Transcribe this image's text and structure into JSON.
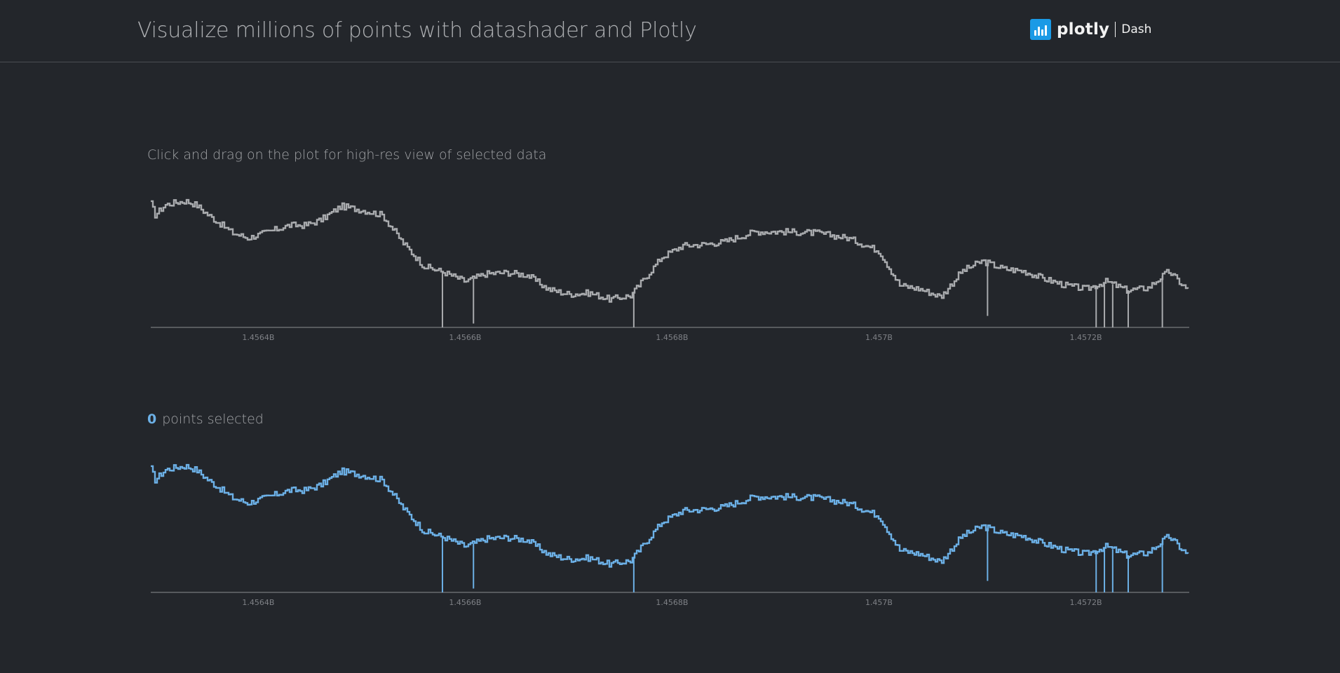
{
  "header": {
    "title": "Visualize millions of points with datashader and Plotly",
    "logo_word": "plotly",
    "logo_dash": "Dash"
  },
  "instruction": "Click and drag on the plot for high-res view of selected data",
  "selection": {
    "count": "0",
    "label": "points selected"
  },
  "colors": {
    "background": "#23262b",
    "overview_line": "#a9abae",
    "selection_line": "#6cb0e6",
    "axis": "#8b8e92",
    "brand": "#1a9ae6"
  },
  "chart_data": [
    {
      "type": "line",
      "title": "",
      "xlabel": "",
      "ylabel": "",
      "x_ticks": [
        "1.4564B",
        "1.4566B",
        "1.4568B",
        "1.457B",
        "1.4572B"
      ],
      "xlim": [
        1456296000,
        1457300000
      ],
      "ylim": [
        0,
        1
      ],
      "grid": false,
      "y_axis_visible": false,
      "series": [
        {
          "x": [
            1456296000,
            1456300000,
            1456310000,
            1456320000,
            1456330000,
            1456340000,
            1456350000,
            1456360000,
            1456375000,
            1456390000,
            1456410000,
            1456430000,
            1456445000,
            1456460000,
            1456480000,
            1456500000,
            1456520000,
            1456540000,
            1456560000,
            1456580000,
            1456600000,
            1456620000,
            1456640000,
            1456660000,
            1456680000,
            1456700000,
            1456720000,
            1456740000,
            1456760000,
            1456790000,
            1456810000,
            1456830000,
            1456850000,
            1456880000,
            1456910000,
            1456940000,
            1456970000,
            1457000000,
            1457020000,
            1457040000,
            1457060000,
            1457080000,
            1457100000,
            1457120000,
            1457140000,
            1457160000,
            1457180000,
            1457200000,
            1457220000,
            1457240000,
            1457260000,
            1457280000,
            1457300000
          ],
          "y": [
            0.97,
            0.88,
            0.96,
            0.98,
            0.99,
            0.96,
            0.89,
            0.83,
            0.74,
            0.7,
            0.75,
            0.8,
            0.8,
            0.84,
            0.95,
            0.92,
            0.88,
            0.66,
            0.48,
            0.43,
            0.36,
            0.42,
            0.43,
            0.41,
            0.3,
            0.26,
            0.27,
            0.22,
            0.25,
            0.55,
            0.64,
            0.65,
            0.67,
            0.75,
            0.75,
            0.74,
            0.7,
            0.6,
            0.33,
            0.3,
            0.24,
            0.44,
            0.52,
            0.46,
            0.44,
            0.38,
            0.33,
            0.3,
            0.36,
            0.29,
            0.31,
            0.44,
            0.28
          ]
        }
      ],
      "spikes": [
        {
          "x": 1456578000,
          "low": 0.0
        },
        {
          "x": 1456608000,
          "low": 0.03
        },
        {
          "x": 1456763000,
          "low": 0.0
        },
        {
          "x": 1457105000,
          "low": 0.09
        },
        {
          "x": 1457210000,
          "low": 0.0
        },
        {
          "x": 1457218000,
          "low": 0.0
        },
        {
          "x": 1457226000,
          "low": 0.0
        },
        {
          "x": 1457241000,
          "low": 0.0
        },
        {
          "x": 1457274000,
          "low": 0.0
        }
      ]
    },
    {
      "type": "line",
      "title": "",
      "xlabel": "",
      "ylabel": "",
      "x_ticks": [
        "1.4564B",
        "1.4566B",
        "1.4568B",
        "1.457B",
        "1.4572B"
      ],
      "xlim": [
        1456296000,
        1457300000
      ],
      "ylim": [
        0,
        1
      ],
      "grid": false,
      "y_axis_visible": false,
      "series": [
        {
          "x": [
            1456296000,
            1456300000,
            1456310000,
            1456320000,
            1456330000,
            1456340000,
            1456350000,
            1456360000,
            1456375000,
            1456390000,
            1456410000,
            1456430000,
            1456445000,
            1456460000,
            1456480000,
            1456500000,
            1456520000,
            1456540000,
            1456560000,
            1456580000,
            1456600000,
            1456620000,
            1456640000,
            1456660000,
            1456680000,
            1456700000,
            1456720000,
            1456740000,
            1456760000,
            1456790000,
            1456810000,
            1456830000,
            1456850000,
            1456880000,
            1456910000,
            1456940000,
            1456970000,
            1457000000,
            1457020000,
            1457040000,
            1457060000,
            1457080000,
            1457100000,
            1457120000,
            1457140000,
            1457160000,
            1457180000,
            1457200000,
            1457220000,
            1457240000,
            1457260000,
            1457280000,
            1457300000
          ],
          "y": [
            0.97,
            0.88,
            0.96,
            0.98,
            0.99,
            0.96,
            0.89,
            0.83,
            0.74,
            0.7,
            0.75,
            0.8,
            0.8,
            0.84,
            0.95,
            0.92,
            0.88,
            0.66,
            0.48,
            0.43,
            0.36,
            0.42,
            0.43,
            0.41,
            0.3,
            0.26,
            0.27,
            0.22,
            0.25,
            0.55,
            0.64,
            0.65,
            0.67,
            0.75,
            0.75,
            0.74,
            0.7,
            0.6,
            0.33,
            0.3,
            0.24,
            0.44,
            0.52,
            0.46,
            0.44,
            0.38,
            0.33,
            0.3,
            0.36,
            0.29,
            0.31,
            0.44,
            0.28
          ]
        }
      ],
      "spikes": [
        {
          "x": 1456578000,
          "low": 0.0
        },
        {
          "x": 1456608000,
          "low": 0.03
        },
        {
          "x": 1456763000,
          "low": 0.0
        },
        {
          "x": 1457105000,
          "low": 0.09
        },
        {
          "x": 1457210000,
          "low": 0.0
        },
        {
          "x": 1457218000,
          "low": 0.0
        },
        {
          "x": 1457226000,
          "low": 0.0
        },
        {
          "x": 1457241000,
          "low": 0.0
        },
        {
          "x": 1457274000,
          "low": 0.0
        }
      ]
    }
  ]
}
